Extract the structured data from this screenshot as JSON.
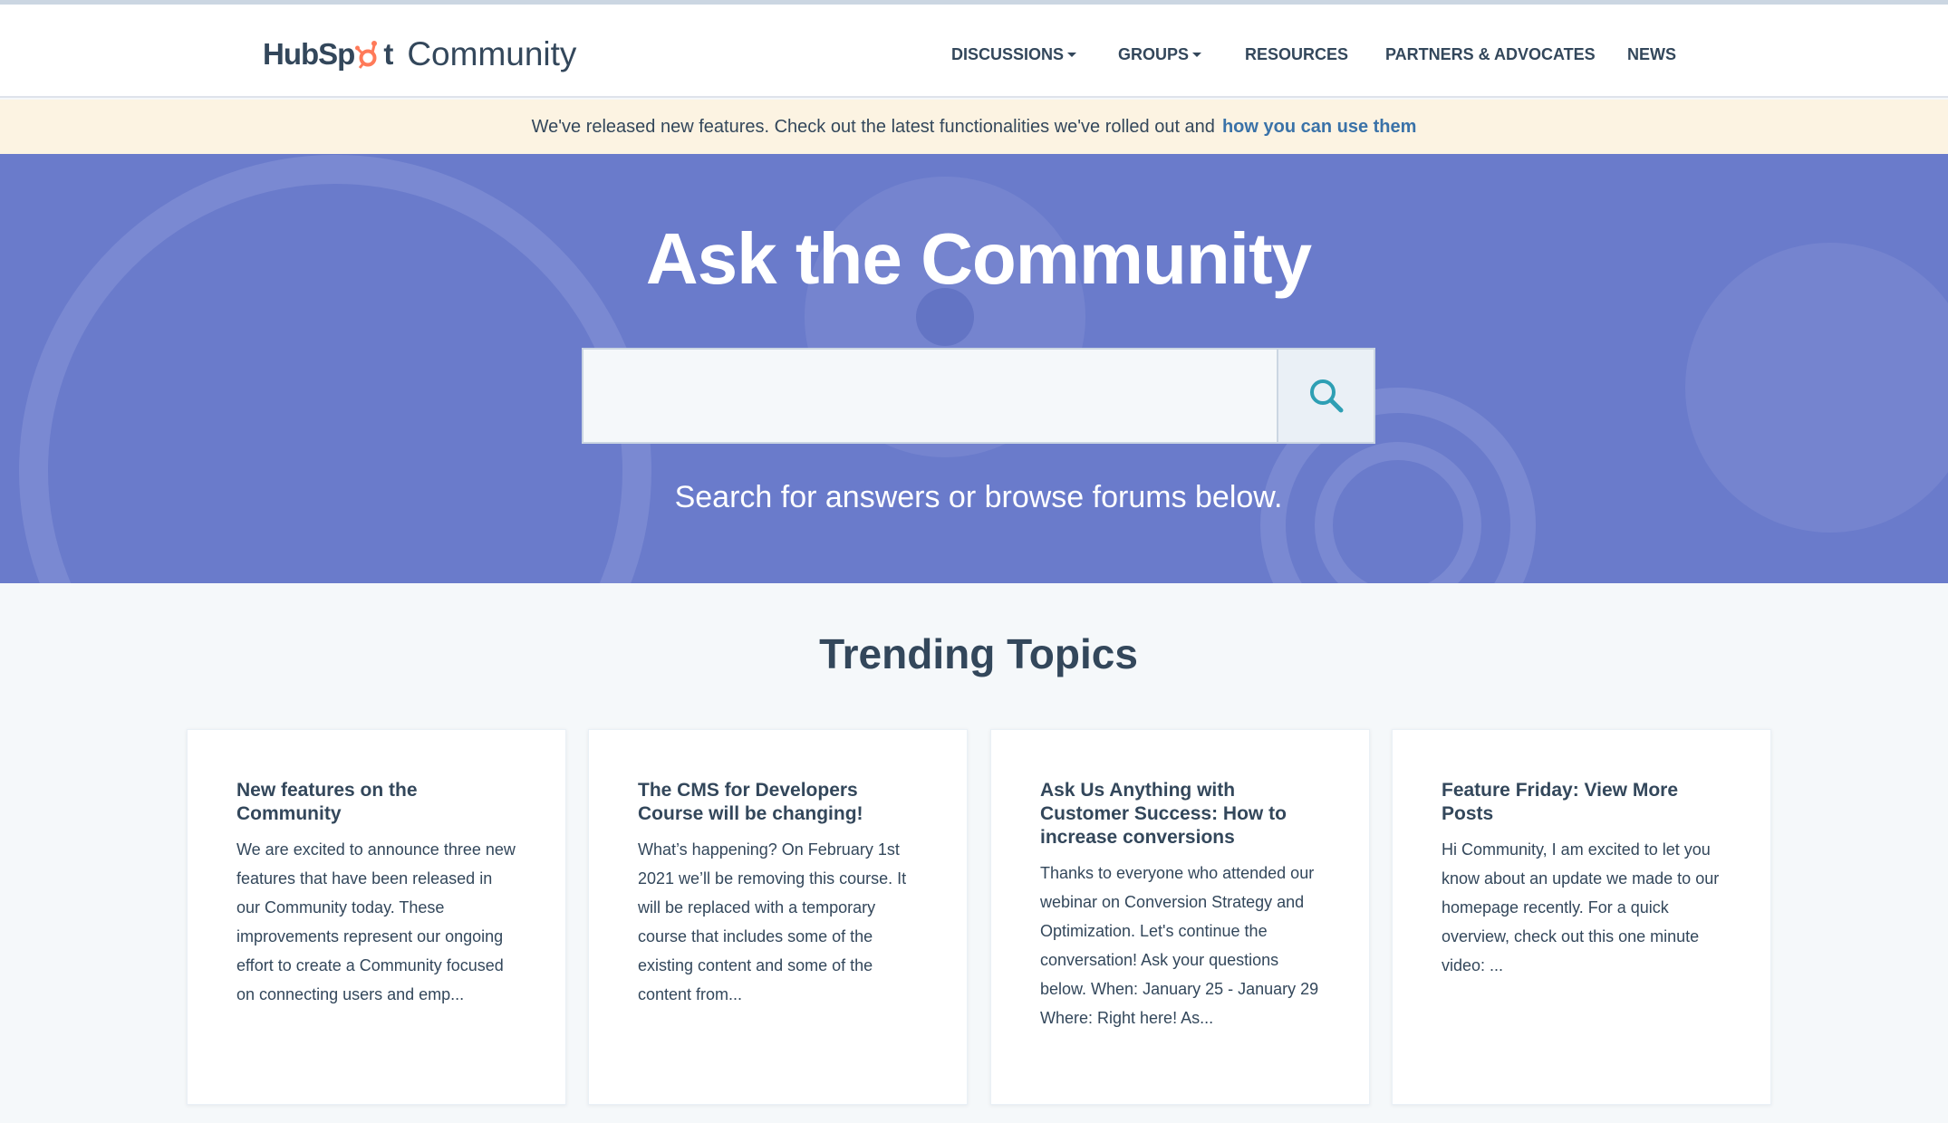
{
  "header": {
    "logo_hubspot_left": "HubSp",
    "logo_hubspot_right": "t",
    "logo_community": "Community",
    "nav": [
      {
        "label": "DISCUSSIONS",
        "has_dropdown": true
      },
      {
        "label": "GROUPS",
        "has_dropdown": true
      },
      {
        "label": "RESOURCES",
        "has_dropdown": false
      },
      {
        "label": "PARTNERS & ADVOCATES",
        "has_dropdown": false
      },
      {
        "label": "NEWS",
        "has_dropdown": false
      }
    ]
  },
  "banner": {
    "text": "We've released new features. Check out the latest functionalities we've rolled out and",
    "link_text": "how you can use them"
  },
  "hero": {
    "title": "Ask the Community",
    "search_value": "",
    "search_placeholder": "",
    "subtitle": "Search for answers or browse forums below."
  },
  "trending": {
    "title": "Trending Topics",
    "cards": [
      {
        "title": "New features on the Community",
        "body": "We are excited to announce three new features that have been released in our Community today. These improvements represent our ongoing effort to create a Community focused on connecting users and emp..."
      },
      {
        "title": "The CMS for Developers Course will be changing!",
        "body": "What’s happening?   On February 1st 2021 we’ll be removing this course. It will be replaced with a temporary course that includes some of the existing content and some of the content from..."
      },
      {
        "title": "Ask Us Anything with Customer Success: How to increase conversions",
        "body": "Thanks to everyone who attended our webinar on Conversion Strategy and Optimization. Let's continue the conversation! Ask your questions below. When: January 25 - January 29 Where: Right here! As..."
      },
      {
        "title": "Feature Friday: View More Posts",
        "body": "Hi Community,    I am excited to let you know about an update we made to our homepage recently. For a quick overview, check out this one minute video:  ..."
      }
    ]
  },
  "colors": {
    "brand_orange": "#ff7a59",
    "hero_bg": "#6a7bcb",
    "banner_bg": "#fcf3e2",
    "link": "#3a72a8",
    "text": "#33475b",
    "search_icon": "#2e9fb4"
  },
  "icons": [
    "sprocket-icon",
    "search-icon",
    "caret-down-icon"
  ]
}
